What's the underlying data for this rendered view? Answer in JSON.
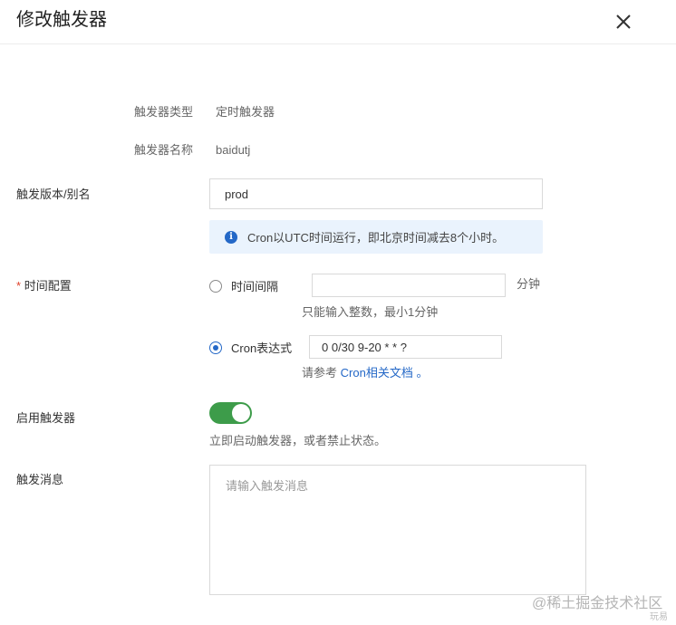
{
  "dialog": {
    "title": "修改触发器"
  },
  "form": {
    "trigger_type": {
      "label": "触发器类型",
      "value": "定时触发器"
    },
    "trigger_name": {
      "label": "触发器名称",
      "value": "baidutj"
    },
    "version_alias": {
      "label": "触发版本/别名",
      "value": "prod"
    },
    "info_notice": "Cron以UTC时间运行，即北京时间减去8个小时。",
    "time_config": {
      "required_mark": "*",
      "label": "时间配置",
      "interval_option": {
        "label": "时间间隔",
        "value": "",
        "unit": "分钟",
        "hint": "只能输入整数，最小1分钟",
        "selected": false
      },
      "cron_option": {
        "label": "Cron表达式",
        "value": "0 0/30 9-20 * * ?",
        "hint_prefix": "请参考",
        "hint_link": "Cron相关文档",
        "hint_suffix": "。",
        "selected": true
      }
    },
    "enable": {
      "label": "启用触发器",
      "on": true,
      "hint": "立即启动触发器，或者禁止状态。"
    },
    "message": {
      "label": "触发消息",
      "placeholder": "请输入触发消息"
    }
  },
  "watermark": {
    "main": "@稀土掘金技术社区",
    "sub": "玩易"
  },
  "colors": {
    "accent": "#2468c7",
    "toggle_on": "#3d9c4a",
    "info_bg": "#eaf3fd",
    "required": "#e0412a"
  }
}
